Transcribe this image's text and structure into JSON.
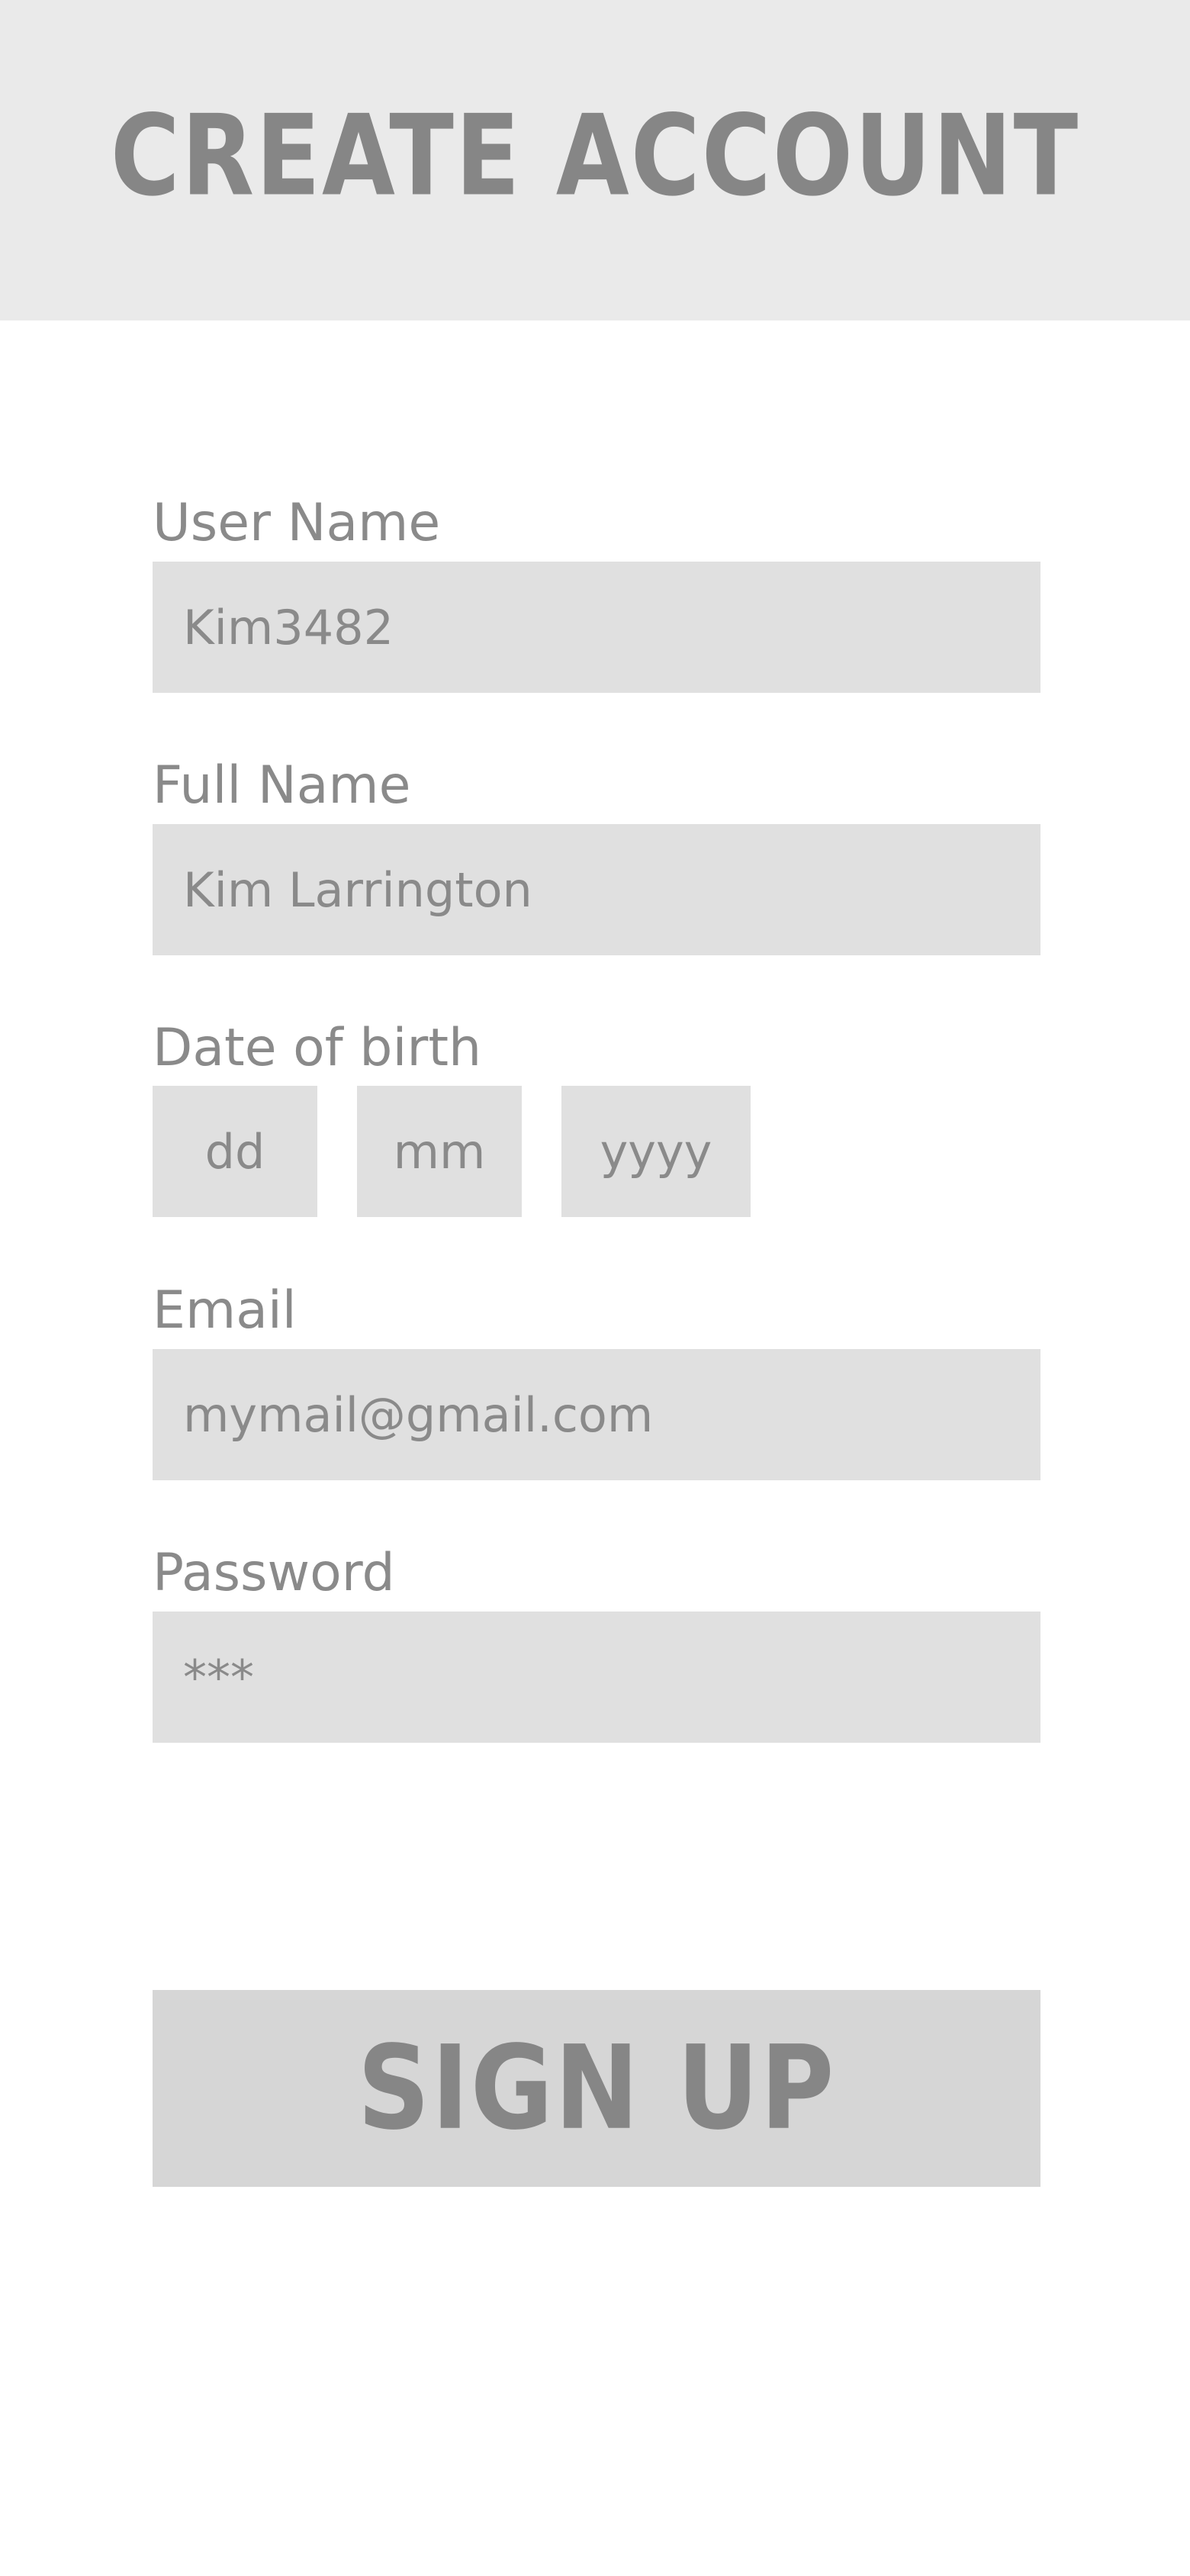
{
  "header": {
    "title": "CREATE ACCOUNT"
  },
  "form": {
    "username": {
      "label": "User Name",
      "value": "Kim3482"
    },
    "fullname": {
      "label": "Full Name",
      "value": "Kim Larrington"
    },
    "dob": {
      "label": "Date of birth",
      "day_placeholder": "dd",
      "month_placeholder": "mm",
      "year_placeholder": "yyyy"
    },
    "email": {
      "label": "Email",
      "value": "mymail@gmail.com"
    },
    "password": {
      "label": "Password",
      "value": "***"
    },
    "submit_label": "SIGN UP"
  },
  "colors": {
    "header_bg": "#eaeaea",
    "field_bg": "#e0e0e0",
    "button_bg": "#d6d6d6",
    "text": "#8a8a8a"
  }
}
